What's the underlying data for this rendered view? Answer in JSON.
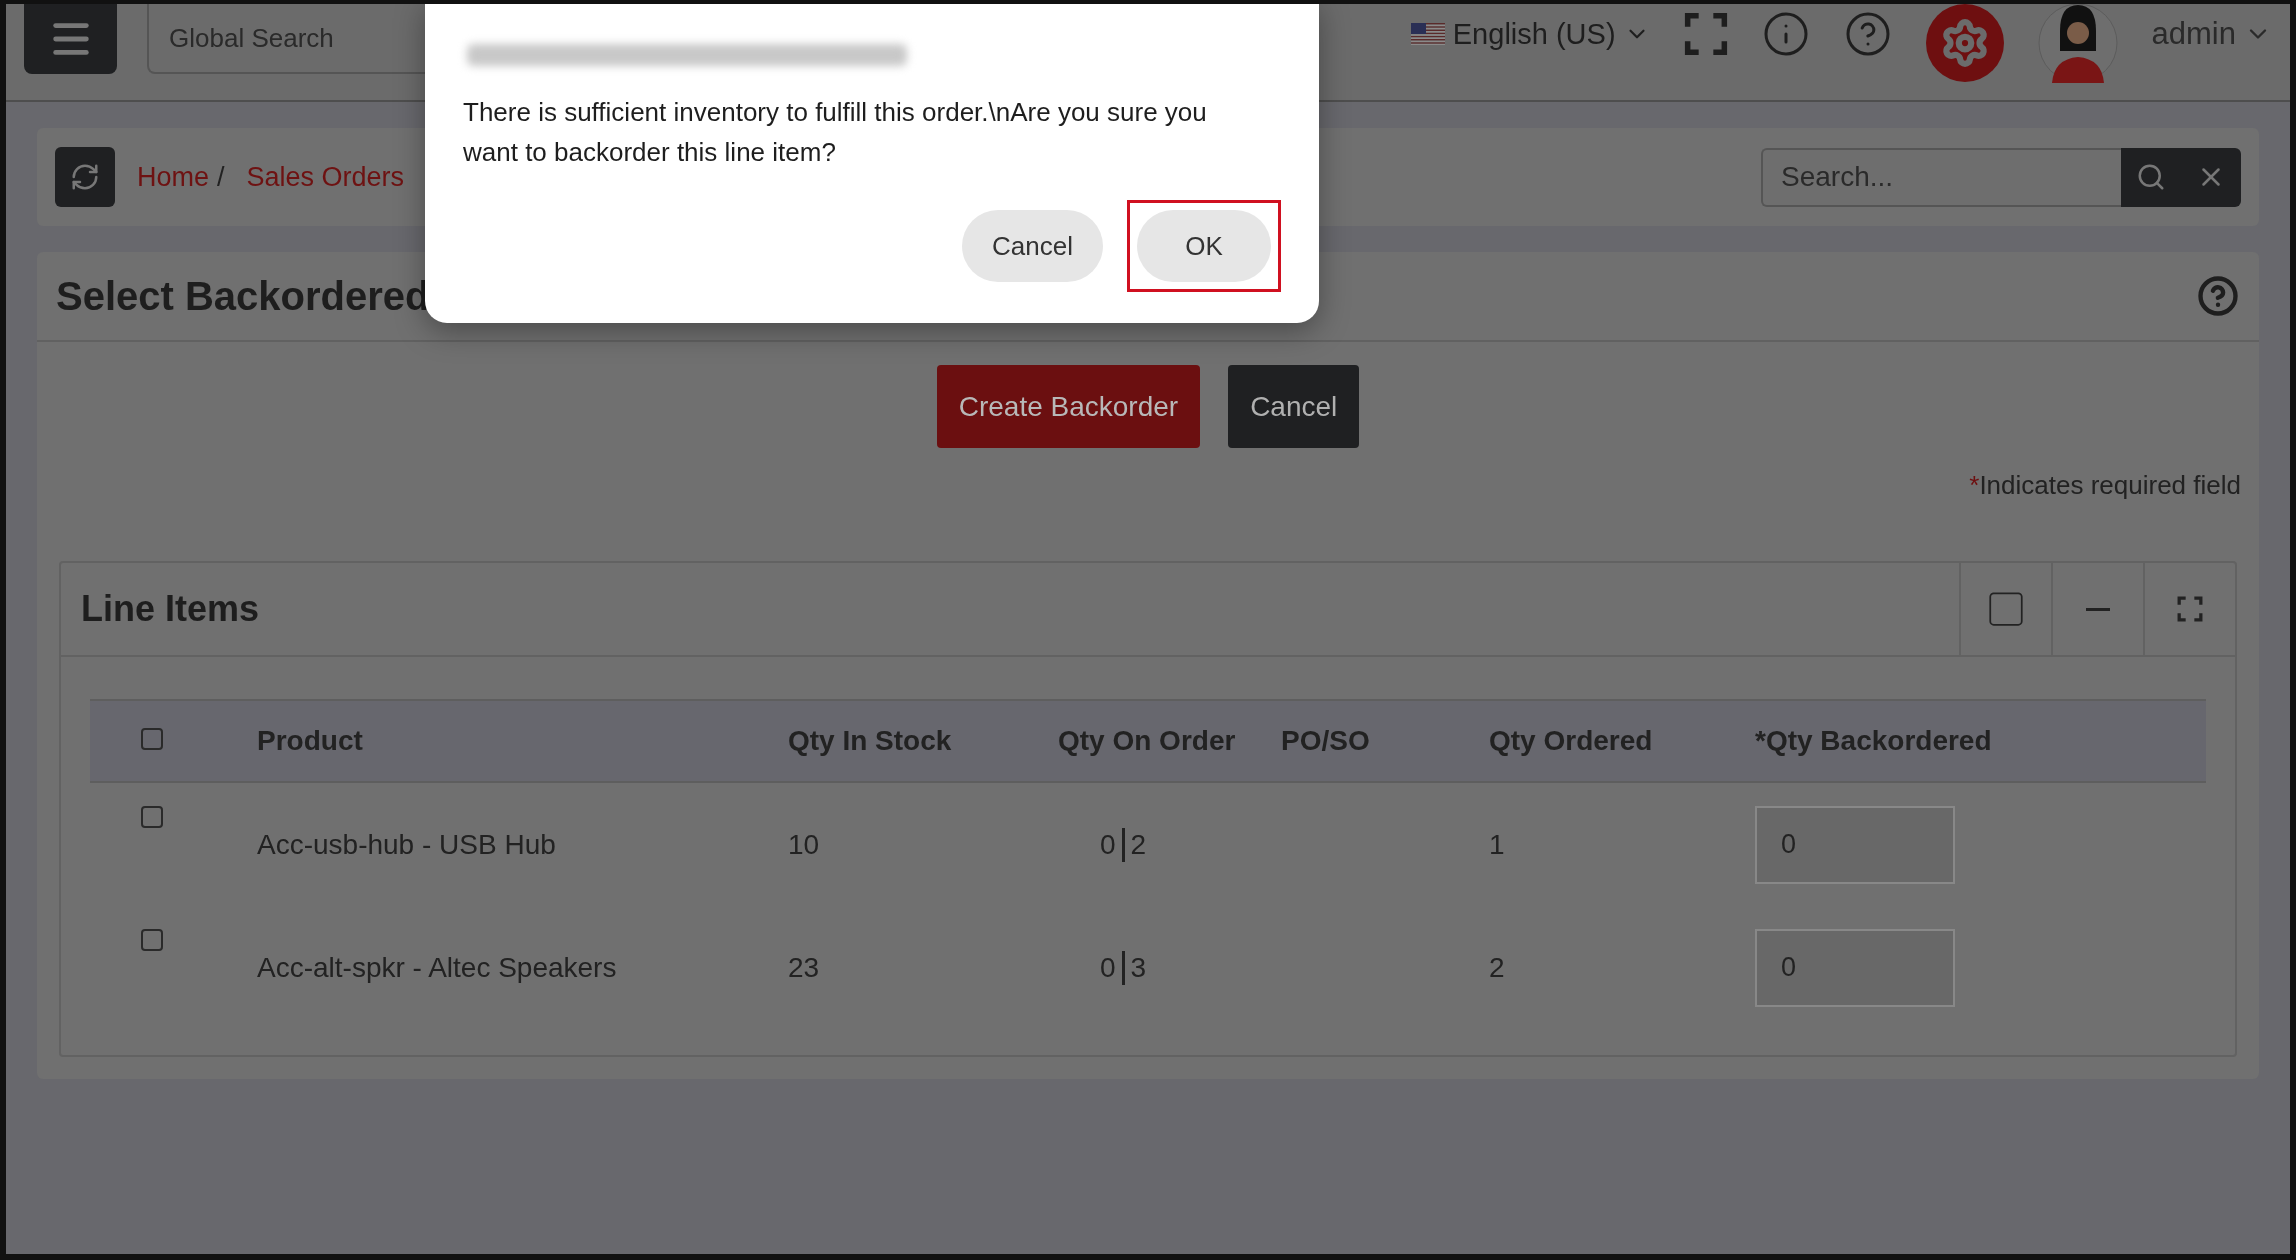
{
  "topbar": {
    "global_search": {
      "placeholder": "Global Search"
    },
    "language": "English (US)",
    "user": "admin"
  },
  "breadcrumb": [
    {
      "label": "Home"
    },
    {
      "label": "Sales Orders"
    }
  ],
  "breadcrumb_separator": "/",
  "search": {
    "placeholder": "Search..."
  },
  "page_title": "Select Backordered",
  "actions": [
    {
      "label": "Create Backorder",
      "kind": "primary"
    },
    {
      "label": "Cancel",
      "kind": "dark"
    }
  ],
  "required_note": {
    "mark": "*",
    "text": "Indicates required field"
  },
  "panel": {
    "title": "Line Items"
  },
  "table": {
    "header_checked": false,
    "columns": [
      "Product",
      "Qty In Stock",
      "Qty On Order",
      "PO/SO",
      "Qty Ordered",
      "*Qty Backordered"
    ],
    "rows": [
      {
        "checked": false,
        "product": "Acc-usb-hub - USB Hub",
        "qty_in_stock": "10",
        "qty_on_order": [
          "0",
          "2"
        ],
        "qty_ordered": "1",
        "qty_backordered": "0"
      },
      {
        "checked": false,
        "product": "Acc-alt-spkr - Altec Speakers",
        "qty_in_stock": "23",
        "qty_on_order": [
          "0",
          "3"
        ],
        "qty_ordered": "2",
        "qty_backordered": "0"
      }
    ]
  },
  "dialog": {
    "message": "There is sufficient inventory to fulfill this order.\\nAre you sure you want to backorder this line item?",
    "buttons": [
      {
        "label": "Cancel",
        "highlighted": false
      },
      {
        "label": "OK",
        "highlighted": true
      }
    ]
  }
}
